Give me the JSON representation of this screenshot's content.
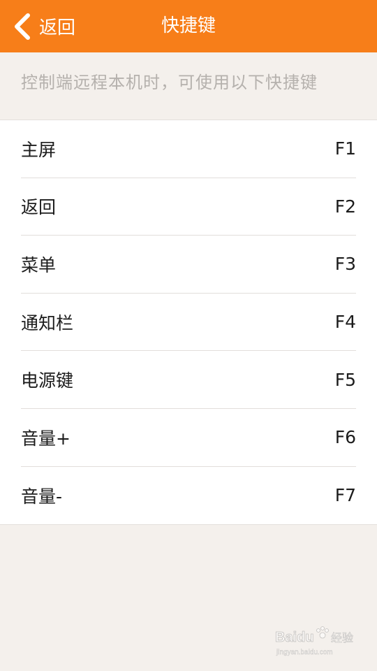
{
  "header": {
    "back_label": "返回",
    "title": "快捷键"
  },
  "description": "控制端远程本机时，可使用以下快捷键",
  "shortcuts": [
    {
      "label": "主屏",
      "key": "F1"
    },
    {
      "label": "返回",
      "key": "F2"
    },
    {
      "label": "菜单",
      "key": "F3"
    },
    {
      "label": "通知栏",
      "key": "F4"
    },
    {
      "label": "电源键",
      "key": "F5"
    },
    {
      "label": "音量+",
      "key": "F6"
    },
    {
      "label": "音量-",
      "key": "F7"
    }
  ],
  "watermark": {
    "brand": "Baidu",
    "subtitle": "经验",
    "url": "jingyan.baidu.com"
  },
  "colors": {
    "header": "#f77e19",
    "background": "#f4f0ec",
    "description_text": "#b5b1ad"
  }
}
